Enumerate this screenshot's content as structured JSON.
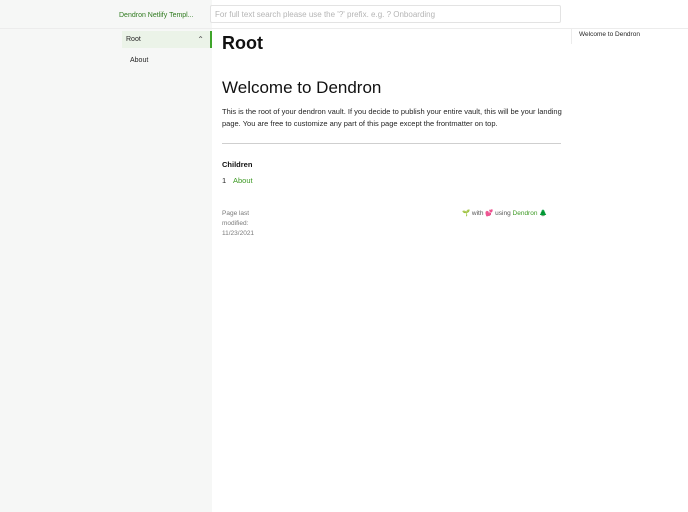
{
  "header": {
    "logo_text": "Dendron Netlify Templ...",
    "search_placeholder": "For full text search please use the '?' prefix. e.g. ? Onboarding"
  },
  "sidebar": {
    "items": [
      {
        "label": "Root",
        "selected": true,
        "expanded": true
      },
      {
        "label": "About"
      }
    ]
  },
  "main": {
    "page_title": "Root",
    "heading": "Welcome to Dendron",
    "paragraph": "This is the root of your dendron vault. If you decide to publish your entire vault, this will be your landing page. You are free to customize any part of this page except the frontmatter on top.",
    "children_title": "Children",
    "children": [
      {
        "num": "1",
        "label": "About"
      }
    ]
  },
  "footer": {
    "modified_text": "Page last modified: 11/23/2021",
    "credit_with": "🌱 with 💕 using",
    "credit_link": "Dendron",
    "credit_tree": "🌲"
  },
  "toc": {
    "items": [
      "Welcome to Dendron"
    ]
  },
  "colors": {
    "accent": "#3d9a24",
    "sidebar_bg": "#f6f7f6",
    "selected_bg": "#ebf3e8"
  }
}
